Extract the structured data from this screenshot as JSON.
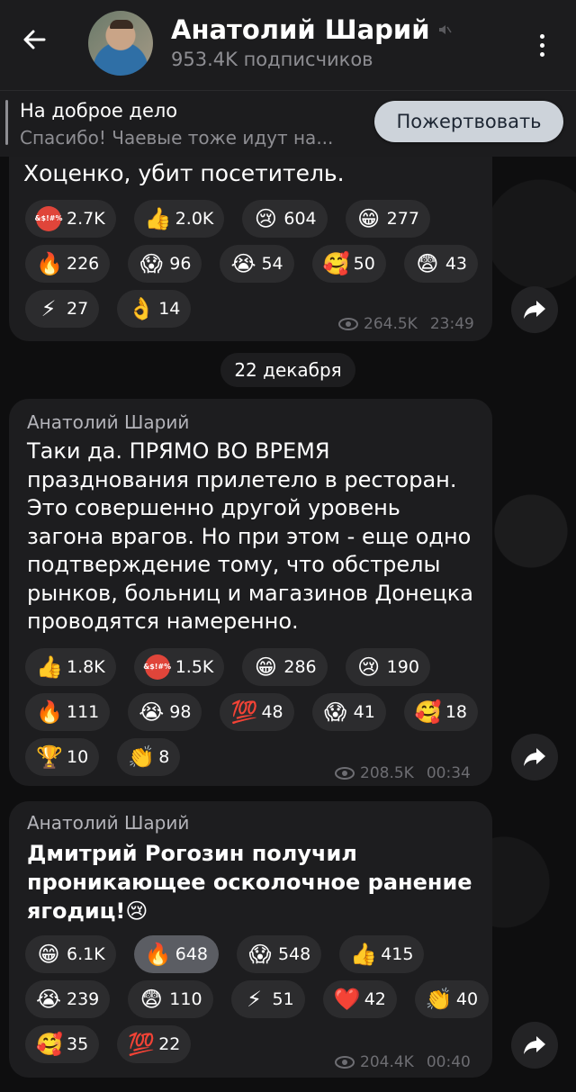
{
  "header": {
    "title": "Анатолий Шарий",
    "subtitle": "953.4K подписчиков"
  },
  "pinned": {
    "title": "На доброе дело",
    "text": "Спасибо! Чаевые тоже идут на...",
    "button_label": "Пожертвовать"
  },
  "messages": [
    {
      "text": "Хоценко, убит посетитель.",
      "reactions": [
        {
          "emoji": "&$!#%",
          "icon": "angry-face-icon",
          "count": "2.7K"
        },
        {
          "emoji": "👍",
          "icon": "thumbs-up-icon",
          "count": "2.0K"
        },
        {
          "emoji": "😢",
          "icon": "crying-face-icon",
          "count": "604"
        },
        {
          "emoji": "😁",
          "icon": "grin-face-icon",
          "count": "277"
        },
        {
          "emoji": "🔥",
          "icon": "fire-icon",
          "count": "226"
        },
        {
          "emoji": "😱",
          "icon": "scream-face-icon",
          "count": "96"
        },
        {
          "emoji": "😭",
          "icon": "sobbing-face-icon",
          "count": "54"
        },
        {
          "emoji": "🥰",
          "icon": "smiling-hearts-face-icon",
          "count": "50"
        },
        {
          "emoji": "😨",
          "icon": "fearful-face-icon",
          "count": "43"
        },
        {
          "emoji": "⚡",
          "icon": "lightning-icon",
          "count": "27"
        },
        {
          "emoji": "👌",
          "icon": "ok-hand-icon",
          "count": "14"
        }
      ],
      "views": "264.5K",
      "time": "23:49"
    },
    {
      "author": "Анатолий Шарий",
      "text": "Таки да. ПРЯМО ВО ВРЕМЯ празднования прилетело в ресторан. Это совершенно другой уровень загона врагов. Но при этом - еще одно подтверждение тому, что обстрелы рынков, больниц и магазинов Донецка проводятся намеренно.",
      "reactions": [
        {
          "emoji": "👍",
          "icon": "thumbs-up-icon",
          "count": "1.8K"
        },
        {
          "emoji": "&$!#%",
          "icon": "angry-face-icon",
          "count": "1.5K"
        },
        {
          "emoji": "😁",
          "icon": "grin-face-icon",
          "count": "286"
        },
        {
          "emoji": "😢",
          "icon": "crying-face-icon",
          "count": "190"
        },
        {
          "emoji": "🔥",
          "icon": "fire-icon",
          "count": "111"
        },
        {
          "emoji": "😭",
          "icon": "sobbing-face-icon",
          "count": "98"
        },
        {
          "emoji": "💯",
          "icon": "hundred-points-icon",
          "count": "48"
        },
        {
          "emoji": "😱",
          "icon": "scream-face-icon",
          "count": "41"
        },
        {
          "emoji": "🥰",
          "icon": "smiling-hearts-face-icon",
          "count": "18"
        },
        {
          "emoji": "🏆",
          "icon": "trophy-icon",
          "count": "10"
        },
        {
          "emoji": "👏",
          "icon": "clapping-hands-icon",
          "count": "8"
        }
      ],
      "views": "208.5K",
      "time": "00:34"
    },
    {
      "author": "Анатолий Шарий",
      "text": "Дмитрий Рогозин получил проникающее осколочное ранение ягодиц!😢",
      "reactions": [
        {
          "emoji": "😁",
          "icon": "grin-face-icon",
          "count": "6.1K"
        },
        {
          "emoji": "🔥",
          "icon": "fire-icon",
          "count": "648",
          "selected": true
        },
        {
          "emoji": "😱",
          "icon": "scream-face-icon",
          "count": "548"
        },
        {
          "emoji": "👍",
          "icon": "thumbs-up-icon",
          "count": "415"
        },
        {
          "emoji": "😭",
          "icon": "sobbing-face-icon",
          "count": "239"
        },
        {
          "emoji": "😨",
          "icon": "fearful-face-icon",
          "count": "110"
        },
        {
          "emoji": "⚡",
          "icon": "lightning-icon",
          "count": "51"
        },
        {
          "emoji": "❤️",
          "icon": "heart-icon",
          "count": "42"
        },
        {
          "emoji": "👏",
          "icon": "clapping-hands-icon",
          "count": "40"
        },
        {
          "emoji": "🥰",
          "icon": "smiling-hearts-face-icon",
          "count": "35"
        },
        {
          "emoji": "💯",
          "icon": "hundred-points-icon",
          "count": "22"
        }
      ],
      "views": "204.4K",
      "time": "00:40"
    }
  ],
  "date_separator": "22 декабря",
  "colors": {
    "background": "#0e0e0f",
    "bubble": "#1d1d1f",
    "chip": "#2c2c2e",
    "chip_selected": "#5b5d63",
    "donate_button": "#cdd3da",
    "meta_text": "#6d6d72"
  }
}
